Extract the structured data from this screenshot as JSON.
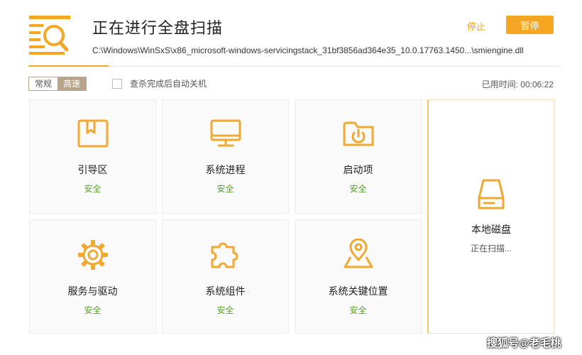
{
  "header": {
    "title": "正在进行全盘扫描",
    "current_path": "C:\\Windows\\WinSxS\\x86_microsoft-windows-servicingstack_31bf3856ad364e35_10.0.17763.1450...\\smiengine.dll",
    "stop_label": "停止",
    "pause_label": "暂停",
    "progress": 0.15
  },
  "toolbar": {
    "mode_normal_label": "常规",
    "mode_fast_label": "高速",
    "selected_mode": "高速",
    "auto_shutdown_label": "查杀完成后自动关机",
    "auto_shutdown_checked": false,
    "elapsed_label": "已用时间:",
    "elapsed_value": "00:06:22"
  },
  "items": [
    {
      "name": "引导区",
      "status": "安全",
      "icon": "boot-sector-icon"
    },
    {
      "name": "系统进程",
      "status": "安全",
      "icon": "monitor-icon"
    },
    {
      "name": "启动项",
      "status": "安全",
      "icon": "startup-folder-icon"
    },
    {
      "name": "服务与驱动",
      "status": "安全",
      "icon": "gear-icon"
    },
    {
      "name": "系统组件",
      "status": "安全",
      "icon": "puzzle-icon"
    },
    {
      "name": "系统关键位置",
      "status": "安全",
      "icon": "map-pin-icon"
    },
    {
      "name": "本地磁盘",
      "status": "正在扫描...",
      "icon": "hard-drive-icon"
    }
  ],
  "watermark": "搜狐号@老毛桃",
  "colors": {
    "accent": "#f5a623",
    "safe": "#5aa02c",
    "mode_active": "#b8a48b"
  }
}
